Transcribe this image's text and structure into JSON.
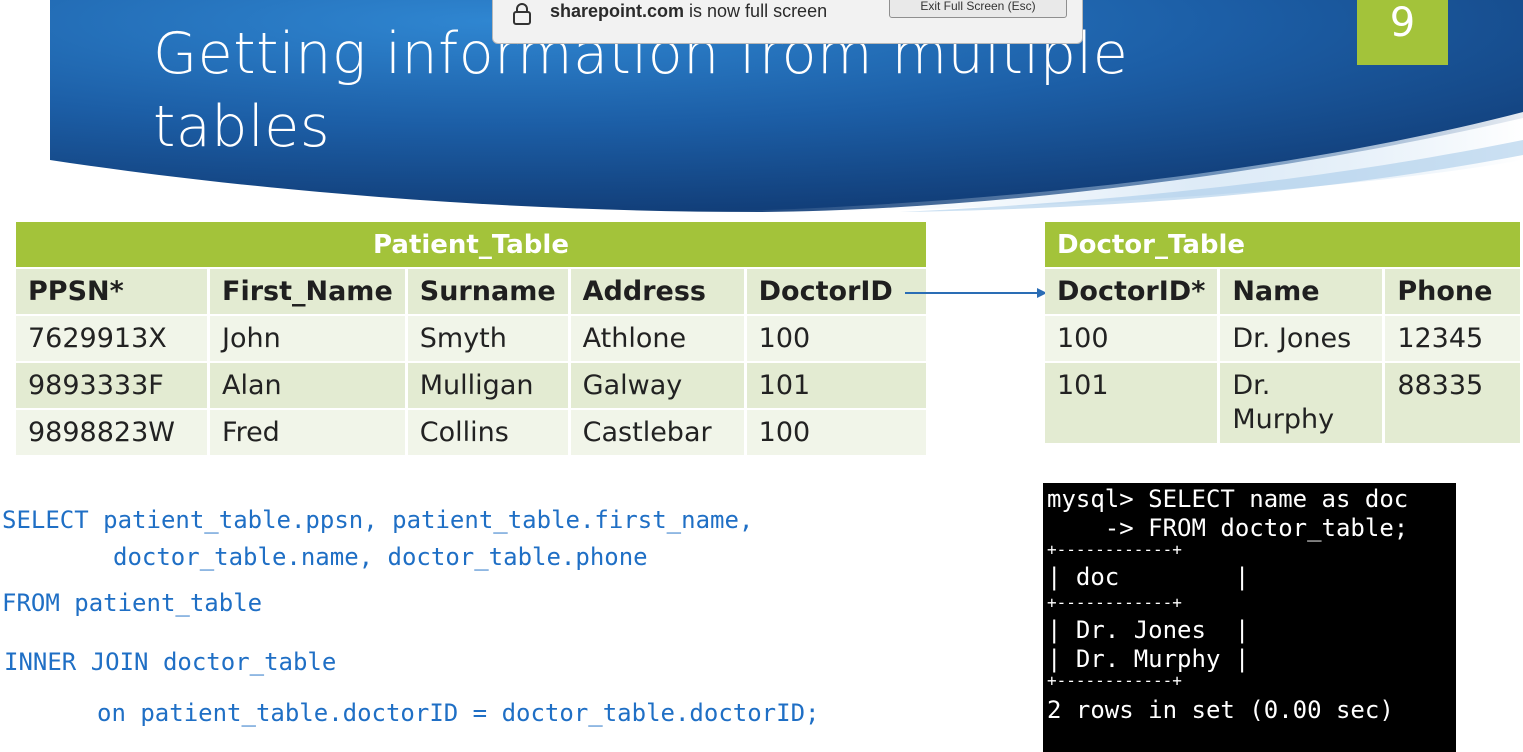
{
  "slide": {
    "title": "Getting information from multiple tables",
    "number": "9"
  },
  "fullscreen_notice": {
    "domain": "sharepoint.com",
    "message": " is now full screen",
    "exit_label": "Exit Full Screen (Esc)",
    "icon": "lock-icon"
  },
  "patient_table": {
    "title": "Patient_Table",
    "columns": [
      "PPSN*",
      "First_Name",
      "Surname",
      "Address",
      "DoctorID"
    ],
    "rows": [
      [
        "7629913X",
        "John",
        "Smyth",
        "Athlone",
        "100"
      ],
      [
        "9893333F",
        "Alan",
        "Mulligan",
        "Galway",
        "101"
      ],
      [
        "9898823W",
        "Fred",
        "Collins",
        "Castlebar",
        "100"
      ]
    ]
  },
  "doctor_table": {
    "title": "Doctor_Table",
    "columns": [
      "DoctorID*",
      "Name",
      "Phone"
    ],
    "rows": [
      [
        "100",
        "Dr. Jones",
        "12345"
      ],
      [
        "101",
        "Dr. Murphy",
        "88335"
      ]
    ]
  },
  "sql": {
    "line1": "SELECT patient_table.ppsn, patient_table.first_name,",
    "line2": "doctor_table.name, doctor_table.phone",
    "line3": "FROM patient_table",
    "line4": "INNER JOIN doctor_table",
    "line5": "on patient_table.doctorID = doctor_table.doctorID;"
  },
  "console": {
    "line1": "mysql> SELECT name as doc",
    "line2": "    -> FROM doctor_table;",
    "border": "+------------+",
    "header": "| doc        |",
    "row1": "| Dr. Jones  |",
    "row2": "| Dr. Murphy |",
    "footer": "2 rows in set (0.00 sec)"
  },
  "colors": {
    "accent_green": "#a3c33a",
    "banner_blue": "#1f5fa8",
    "sql_blue": "#1f6fc5"
  }
}
